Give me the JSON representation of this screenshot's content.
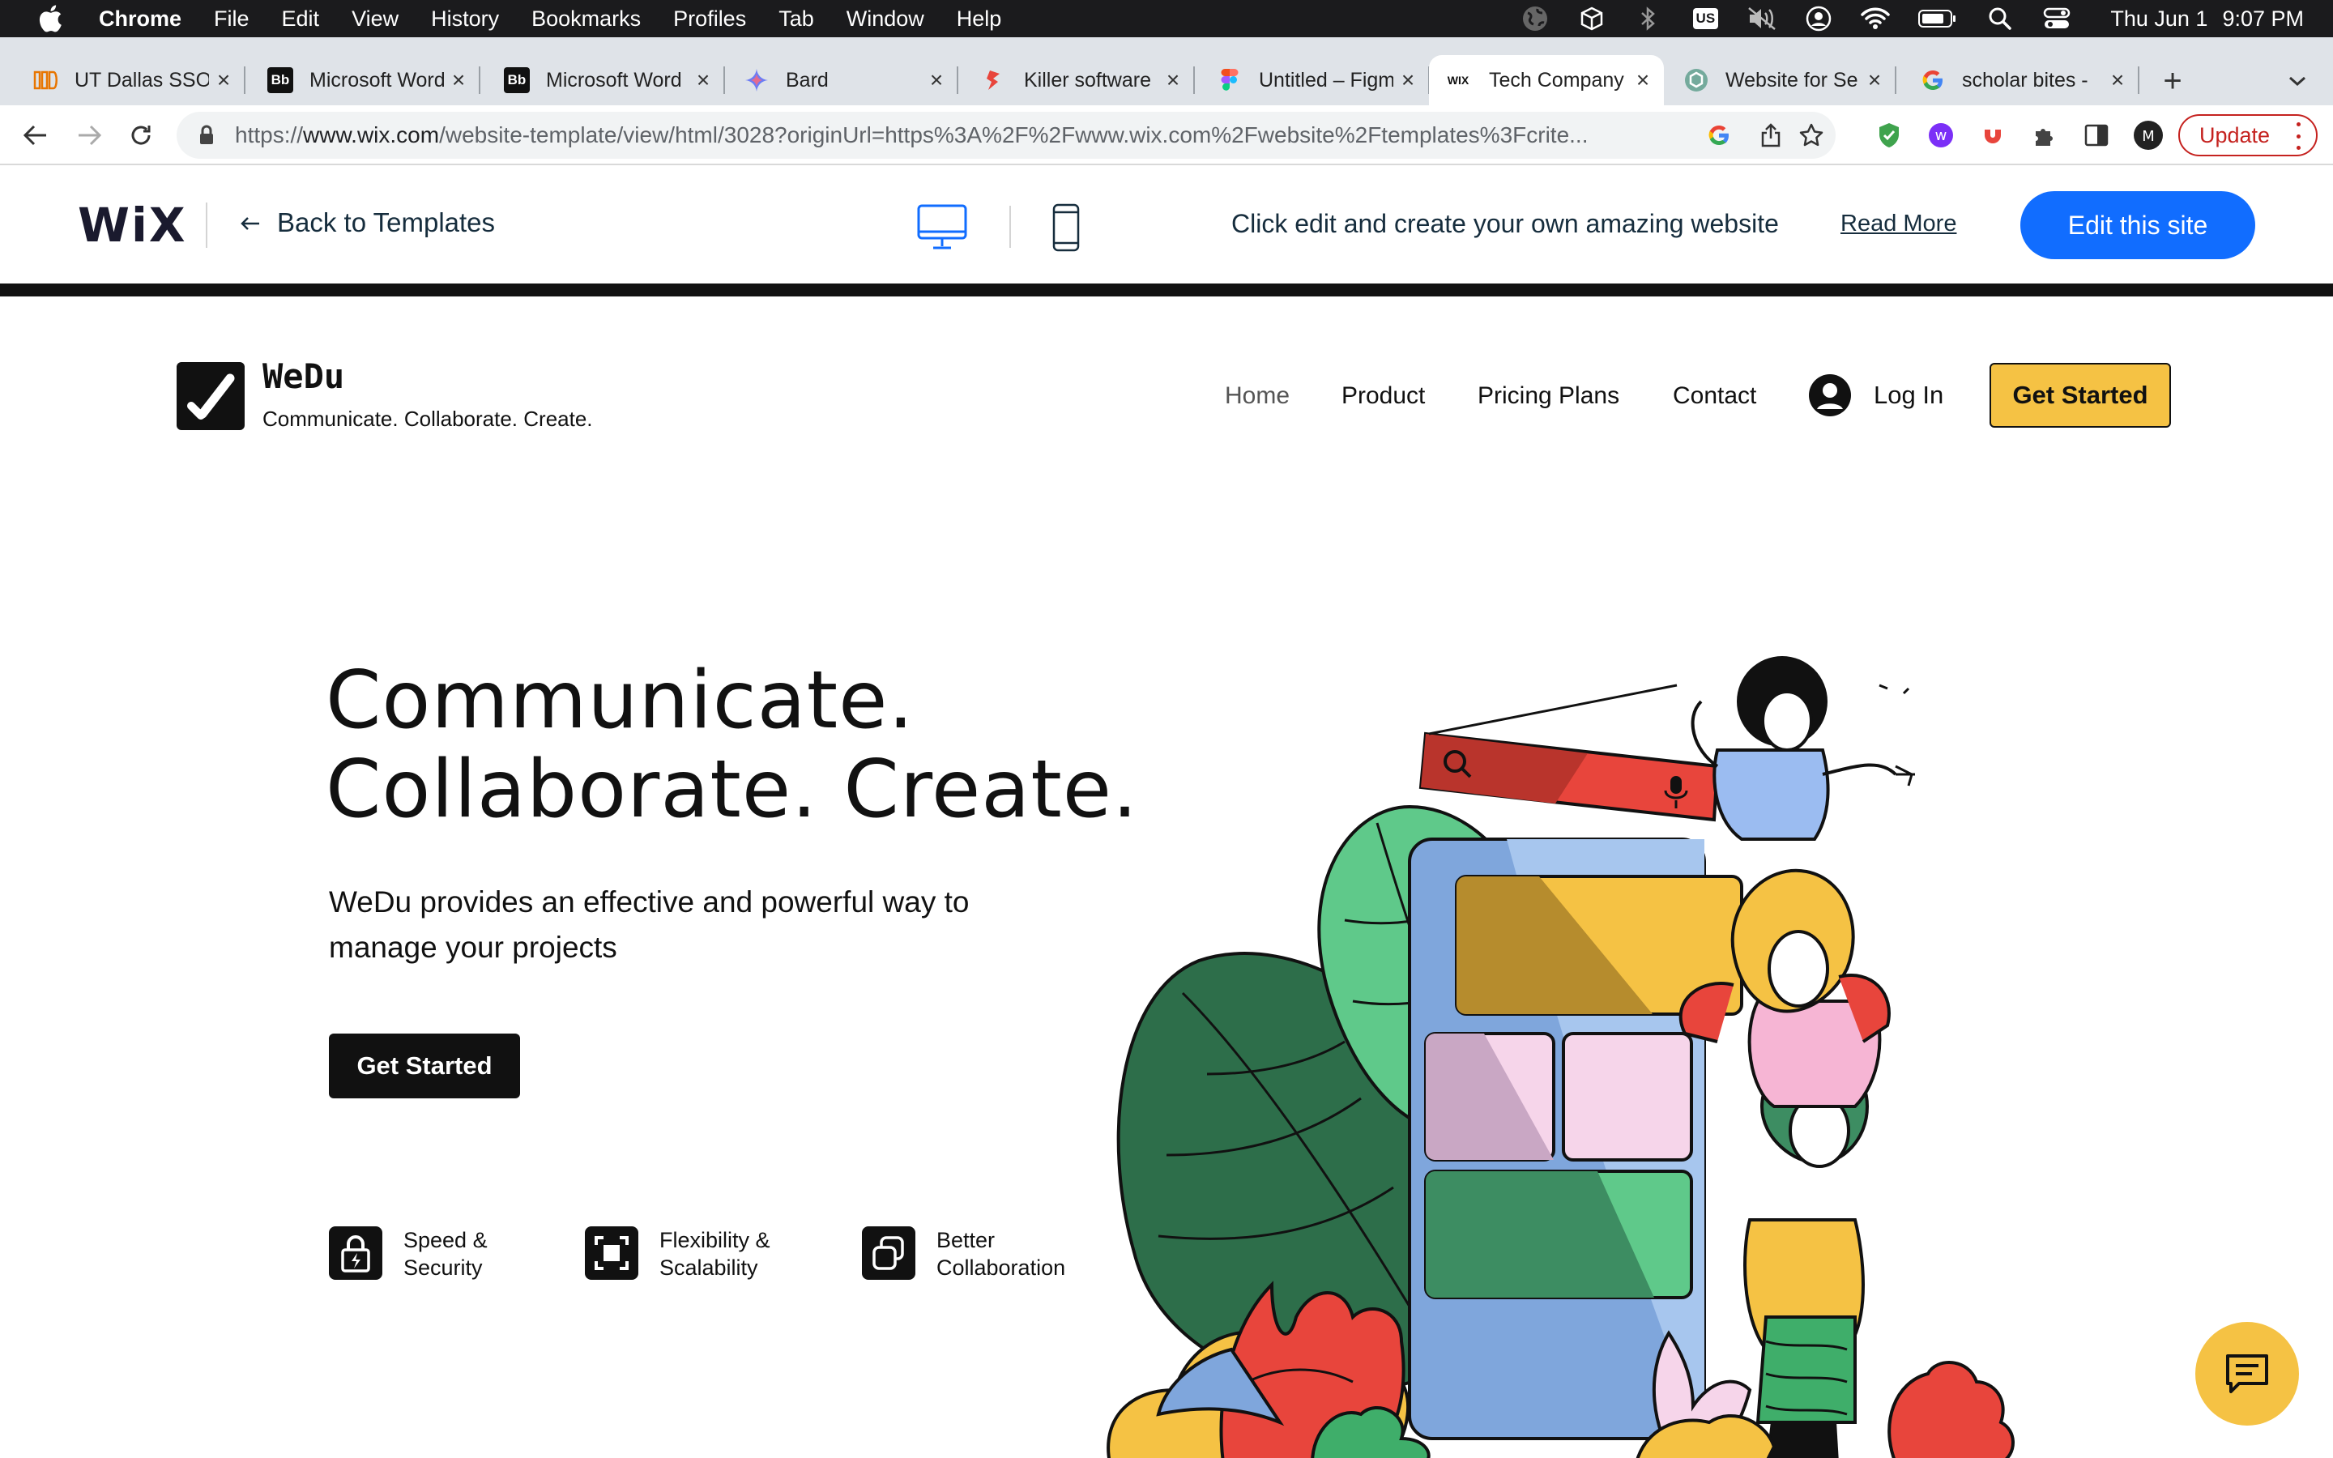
{
  "menubar": {
    "app_name": "Chrome",
    "items": [
      "File",
      "Edit",
      "View",
      "History",
      "Bookmarks",
      "Profiles",
      "Tab",
      "Window",
      "Help"
    ],
    "status_icons": [
      "globe-icon",
      "box-icon",
      "bluetooth-icon",
      "keyboard-us-icon",
      "mute-icon",
      "user-icon",
      "wifi-icon",
      "battery-icon",
      "spotlight-icon",
      "control-center-icon"
    ],
    "keyboard_label": "US",
    "date": "Thu Jun 1",
    "time": "9:07 PM"
  },
  "tabs": [
    {
      "title": "UT Dallas SSO",
      "favicon": "utd-icon",
      "favicon_color": "#e87500",
      "active": false
    },
    {
      "title": "Microsoft Word",
      "favicon": "blackboard-icon",
      "favicon_text": "Bb",
      "favicon_color": "#111111",
      "active": false
    },
    {
      "title": "Microsoft Word",
      "favicon": "blackboard-icon",
      "favicon_text": "Bb",
      "favicon_color": "#111111",
      "active": false
    },
    {
      "title": "Bard",
      "favicon": "bard-icon",
      "favicon_color": "#4f7df3",
      "active": false
    },
    {
      "title": "Killer software",
      "favicon": "flag-icon",
      "favicon_color": "#e8453c",
      "active": false
    },
    {
      "title": "Untitled – Figma",
      "favicon": "figma-icon",
      "favicon_color": "#f24e1e",
      "active": false
    },
    {
      "title": "Tech Company",
      "favicon": "wix-icon",
      "favicon_text": "WIX",
      "favicon_color": "#111111",
      "active": true
    },
    {
      "title": "Website for Se",
      "favicon": "openai-icon",
      "favicon_color": "#74aa9c",
      "active": false
    },
    {
      "title": "scholar bites -",
      "favicon": "google-icon",
      "favicon_color": "#4285f4",
      "active": false
    }
  ],
  "address_bar": {
    "url_scheme": "https://",
    "url_host": "www.wix.com",
    "url_rest": "/website-template/view/html/3028?originUrl=https%3A%2F%2Fwww.wix.com%2Fwebsite%2Ftemplates%3Fcrite...",
    "update_label": "Update"
  },
  "wix_header": {
    "logo": "WiX",
    "back_label": "Back to Templates",
    "promo_text": "Click edit and create your own amazing website",
    "read_more": "Read More",
    "edit_button": "Edit this site",
    "accent_color": "#116dff"
  },
  "site": {
    "brand": "WeDu",
    "tagline": "Communicate. Collaborate. Create.",
    "nav": [
      "Home",
      "Product",
      "Pricing Plans",
      "Contact"
    ],
    "login": "Log In",
    "nav_cta": "Get Started",
    "hero_title_line1": "Communicate.",
    "hero_title_line2": "Collaborate. Create.",
    "hero_desc": "WeDu provides an effective and powerful way to manage your projects",
    "hero_cta": "Get Started",
    "features": [
      {
        "label": "Speed &\nSecurity",
        "icon": "lock-bolt-icon"
      },
      {
        "label": "Flexibility &\nScalability",
        "icon": "expand-square-icon"
      },
      {
        "label": "Better\nCollaboration",
        "icon": "overlap-squares-icon"
      }
    ],
    "brand_color": "#f5c244"
  }
}
